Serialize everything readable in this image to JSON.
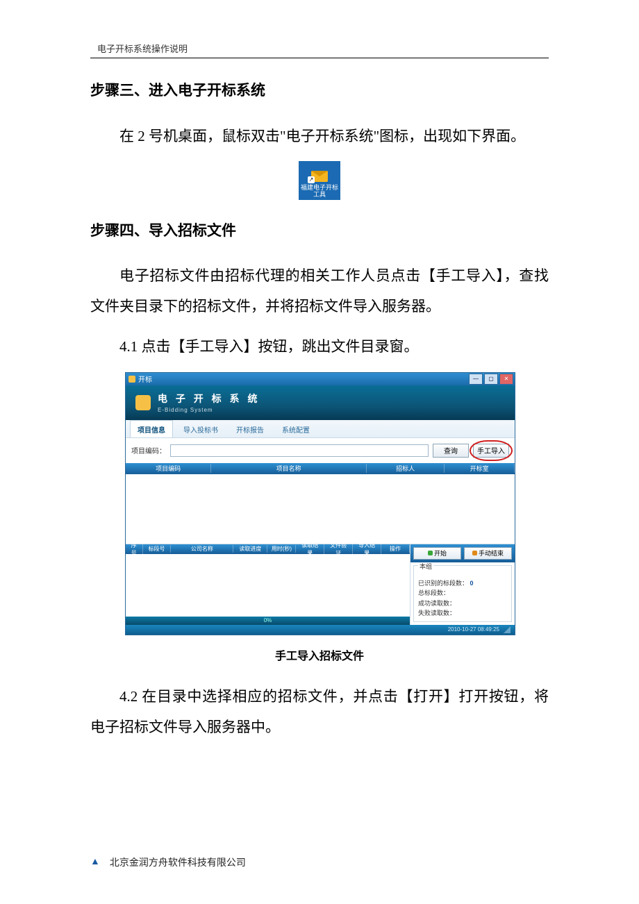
{
  "running_head": "电子开标系统操作说明",
  "step3": {
    "heading": "步骤三、进入电子开标系统",
    "para": "在 2 号机桌面，鼠标双击\"电子开标系统\"图标，出现如下界面。"
  },
  "desktop_icon": {
    "label_line1": "福建电子开标",
    "label_line2": "工具",
    "shortcut_glyph": "↗"
  },
  "step4": {
    "heading": "步骤四、导入招标文件",
    "para1": "电子招标文件由招标代理的相关工作人员点击【手工导入】，查找文件夹目录下的招标文件，并将招标文件导入服务器。",
    "para41": "4.1 点击【手工导入】按钮，跳出文件目录窗。",
    "caption": "手工导入招标文件",
    "para42": "4.2 在目录中选择相应的招标文件，并点击【打开】打开按钮，将电子招标文件导入服务器中。"
  },
  "window": {
    "titlebar": "开标",
    "banner_title": "电 子 开 标 系 统",
    "banner_sub": "E-Bidding System",
    "tabs": [
      "项目信息",
      "导入投标书",
      "开标报告",
      "系统配置"
    ],
    "label_project_code": "项目编码：",
    "btn_query": "查询",
    "btn_manual_import": "手工导入",
    "grid_top_cols": [
      "项目编码",
      "项目名称",
      "招标人",
      "开标室"
    ],
    "grid_bottom_cols": [
      "序号",
      "标段号",
      "公司名称",
      "读取进度",
      "用时(秒)",
      "读取结果",
      "文件验证",
      "导入结果",
      "操作"
    ],
    "progress_pct": "0%",
    "btn_start": "开始",
    "btn_manual_end": "手动结束",
    "group_label": "本组",
    "stats": {
      "read": "已识别的标段数：",
      "read_value": "0",
      "total_bidders": "总标段数：",
      "success": "成功读取数：",
      "fail": "失败读取数："
    },
    "status_time": "2010-10-27 08:49:25"
  },
  "footer": {
    "company": "北京金润方舟软件科技有限公司"
  }
}
